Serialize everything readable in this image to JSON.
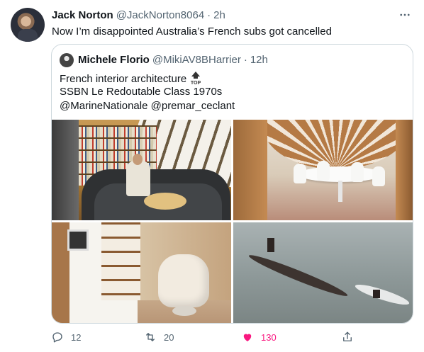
{
  "tweet": {
    "display_name": "Jack Norton",
    "handle": "@JackNorton8064",
    "separator": "·",
    "time": "2h",
    "text": "Now I’m disappointed Australia’s French subs got cancelled",
    "avatar_icon": "user-avatar"
  },
  "quote": {
    "display_name": "Michele Florio",
    "handle": "@MikiAV8BHarrier",
    "separator": "·",
    "time": "12h",
    "lines": {
      "line1": "French interior architecture",
      "line2": "SSBN Le Redoutable Class 1970s",
      "line3": "@MarineNationale @premar_ceclant"
    },
    "emoji": "top-arrow-emoji"
  },
  "photos": [
    {
      "icon": "submarine-lounge-photo"
    },
    {
      "icon": "white-dining-room-photo"
    },
    {
      "icon": "cabinet-armchair-photo"
    },
    {
      "icon": "submarine-at-sea-photo"
    }
  ],
  "actions": {
    "reply_count": "12",
    "retweet_count": "20",
    "like_count": "130",
    "like_color": "#f91880"
  },
  "colors": {
    "secondary_text": "#536471",
    "border": "#cfd9de"
  }
}
